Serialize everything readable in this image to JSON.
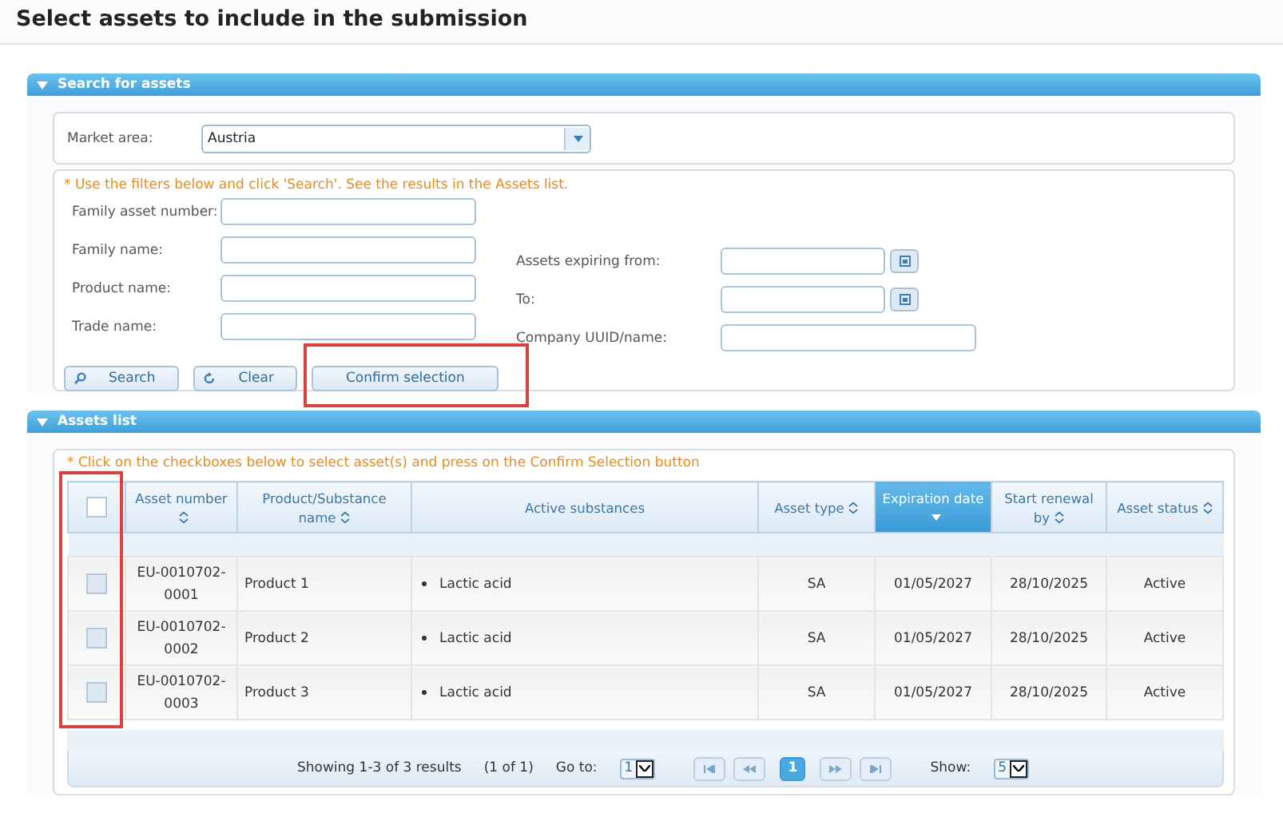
{
  "page_title": "Select assets to include in the submission",
  "search_panel": {
    "title": "Search for assets",
    "expanded": true,
    "market_area": {
      "label": "Market area:",
      "value": "Austria"
    },
    "hint": "* Use the filters below and click 'Search'. See the results in the Assets list.",
    "left_filters": [
      {
        "label": "Family asset number:"
      },
      {
        "label": "Family name:"
      },
      {
        "label": "Product name:"
      },
      {
        "label": "Trade name:"
      }
    ],
    "right_filters": [
      {
        "label": "Assets expiring from:",
        "kind": "date"
      },
      {
        "label": "To:",
        "kind": "date"
      },
      {
        "label": "Company UUID/name:",
        "kind": "text"
      }
    ],
    "buttons": [
      {
        "label": "Search",
        "kind": "search",
        "highlighted": false
      },
      {
        "label": "Clear",
        "kind": "clear",
        "highlighted": false
      },
      {
        "label": "Confirm selection",
        "kind": "plain",
        "highlighted": true
      }
    ]
  },
  "assets_panel": {
    "title": "Assets list",
    "expanded": true,
    "hint": "* Click on the checkboxes below to select asset(s) and press on the Confirm Selection button",
    "checkbox_column_highlighted": true,
    "select_all_checked": false,
    "columns": [
      {
        "label": "Asset number",
        "kind": "value",
        "sorted_descending": false,
        "selected": false
      },
      {
        "label": "Product/Substance name",
        "kind": "name",
        "sorted_descending": false,
        "selected": false
      },
      {
        "label": "Active substances",
        "kind": "list",
        "selected": false
      },
      {
        "label": "Asset type",
        "kind": "value",
        "sorted_descending": false,
        "selected": false
      },
      {
        "label": "Expiration date",
        "kind": "value",
        "sorted_descending": true,
        "selected": true
      },
      {
        "label": "Start renewal by",
        "kind": "value",
        "sorted_descending": false,
        "selected": false
      },
      {
        "label": "Asset status",
        "kind": "value",
        "sorted_descending": false,
        "selected": false
      }
    ],
    "rows": [
      {
        "checked": false,
        "cells": [
          "EU-0010702-0001",
          "Product 1",
          [
            "Lactic acid"
          ],
          "SA",
          "01/05/2027",
          "28/10/2025",
          "Active"
        ]
      },
      {
        "checked": false,
        "cells": [
          "EU-0010702-0002",
          "Product 2",
          [
            "Lactic acid"
          ],
          "SA",
          "01/05/2027",
          "28/10/2025",
          "Active"
        ]
      },
      {
        "checked": false,
        "cells": [
          "EU-0010702-0003",
          "Product 3",
          [
            "Lactic acid"
          ],
          "SA",
          "01/05/2027",
          "28/10/2025",
          "Active"
        ]
      }
    ],
    "pager": {
      "summary": "Showing 1-3 of 3 results",
      "page_of": "(1 of 1)",
      "goto_label": "Go to:",
      "goto_value": "1",
      "pages": [
        {
          "label": "1",
          "selected": true
        }
      ],
      "show_label": "Show:",
      "show_value": "5"
    }
  }
}
